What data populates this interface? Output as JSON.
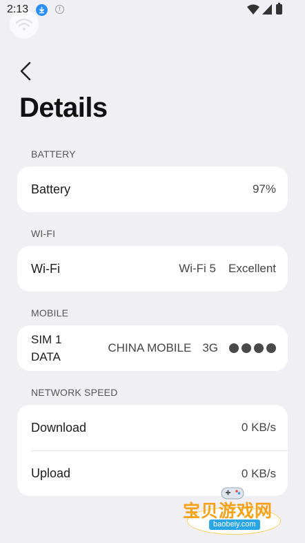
{
  "status_bar": {
    "time": "2:13"
  },
  "header": {
    "title": "Details"
  },
  "sections": {
    "battery": {
      "label": "BATTERY",
      "row_label": "Battery",
      "value": "97%"
    },
    "wifi": {
      "label": "WI-FI",
      "row_label": "Wi-Fi",
      "standard": "Wi-Fi 5",
      "quality": "Excellent"
    },
    "mobile": {
      "label": "MOBILE",
      "sim_line1": "SIM 1",
      "sim_line2": "DATA",
      "carrier": "CHINA MOBILE",
      "network_type": "3G",
      "signal_bars_filled": 4,
      "signal_bars_total": 4
    },
    "network_speed": {
      "label": "NETWORK SPEED",
      "download_label": "Download",
      "download_value": "0 KB/s",
      "upload_label": "Upload",
      "upload_value": "0 KB/s"
    }
  },
  "watermark": {
    "title": "宝贝游戏网",
    "domain": "baobeiy.com"
  },
  "icons": {
    "download_badge": "download-icon",
    "info": "info-icon",
    "wifi": "wifi-icon",
    "cellular": "cellular-signal-icon",
    "battery": "battery-icon",
    "back": "back-arrow-icon"
  },
  "colors": {
    "background": "#efeff4",
    "card": "#ffffff",
    "download_badge": "#2a8ff7",
    "watermark_orange": "#f5a21a",
    "watermark_blue": "#2aa5e6"
  }
}
